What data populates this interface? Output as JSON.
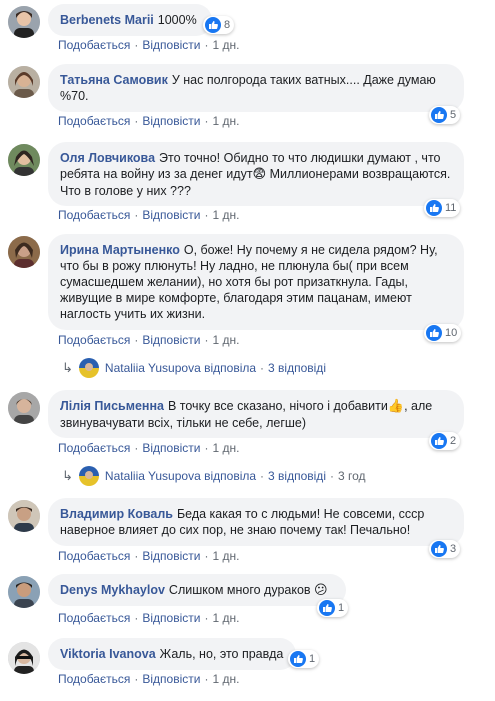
{
  "actions": {
    "like": "Подобається",
    "reply": "Відповісти",
    "sep": "·"
  },
  "comments": [
    {
      "author": "Berbenets Marii",
      "text": "1000%",
      "likes": "8",
      "time": "1 дн."
    },
    {
      "author": "Татьяна Самовик",
      "text": "У нас полгорода таких ватных.... Даже думаю %70.",
      "likes": "5",
      "time": "1 дн."
    },
    {
      "author": "Оля Ловчикова",
      "text": "Это точно! Обидно то что людишки думают , что ребята на войну из за денег идут",
      "emoji": "😨",
      "text2": " Миллионерами возвращаются. Что в голове у них ???",
      "likes": "11",
      "time": "1 дн."
    },
    {
      "author": "Ирина Мартыненко",
      "text": "О, боже! Ну почему я не сидела рядом? Ну, что бы в рожу плюнуть! Ну ладно, не плюнула бы( при всем сумасшедшем желании), но хотя бы рот призаткнула. Гады, живущие в мире комфорте, благодаря этим пацанам, имеют наглость учить их жизни.",
      "likes": "10",
      "time": "1 дн."
    },
    {
      "author": "Лілія Письменна",
      "text": "В точку все сказано, нічого і добавити",
      "emoji": "👍",
      "text2": ", але звинувачувати всіх, тільки не себе, легше)",
      "likes": "2",
      "time": "1 дн."
    },
    {
      "author": "Владимир Коваль",
      "text": "Беда какая то с людьми! Не совсеми, ссср наверное влияет до сих пор, не знаю почему так! Печально!",
      "likes": "3",
      "time": "1 дн."
    },
    {
      "author": "Denys Mykhaylov",
      "text": "Слишком много дураков",
      "emoji": "😕",
      "likes": "1",
      "time": "1 дн."
    },
    {
      "author": "Viktoria Ivanova",
      "text": "Жаль, но, это правда",
      "likes": "1",
      "time": "1 дн."
    }
  ],
  "replies": [
    {
      "name": "Nataliia Yusupova",
      "verb": "відповіла",
      "count": "3 відповіді",
      "time": ""
    },
    {
      "name": "Nataliia Yusupova",
      "verb": "відповіла",
      "count": "3 відповіді",
      "time": "3 год"
    }
  ]
}
